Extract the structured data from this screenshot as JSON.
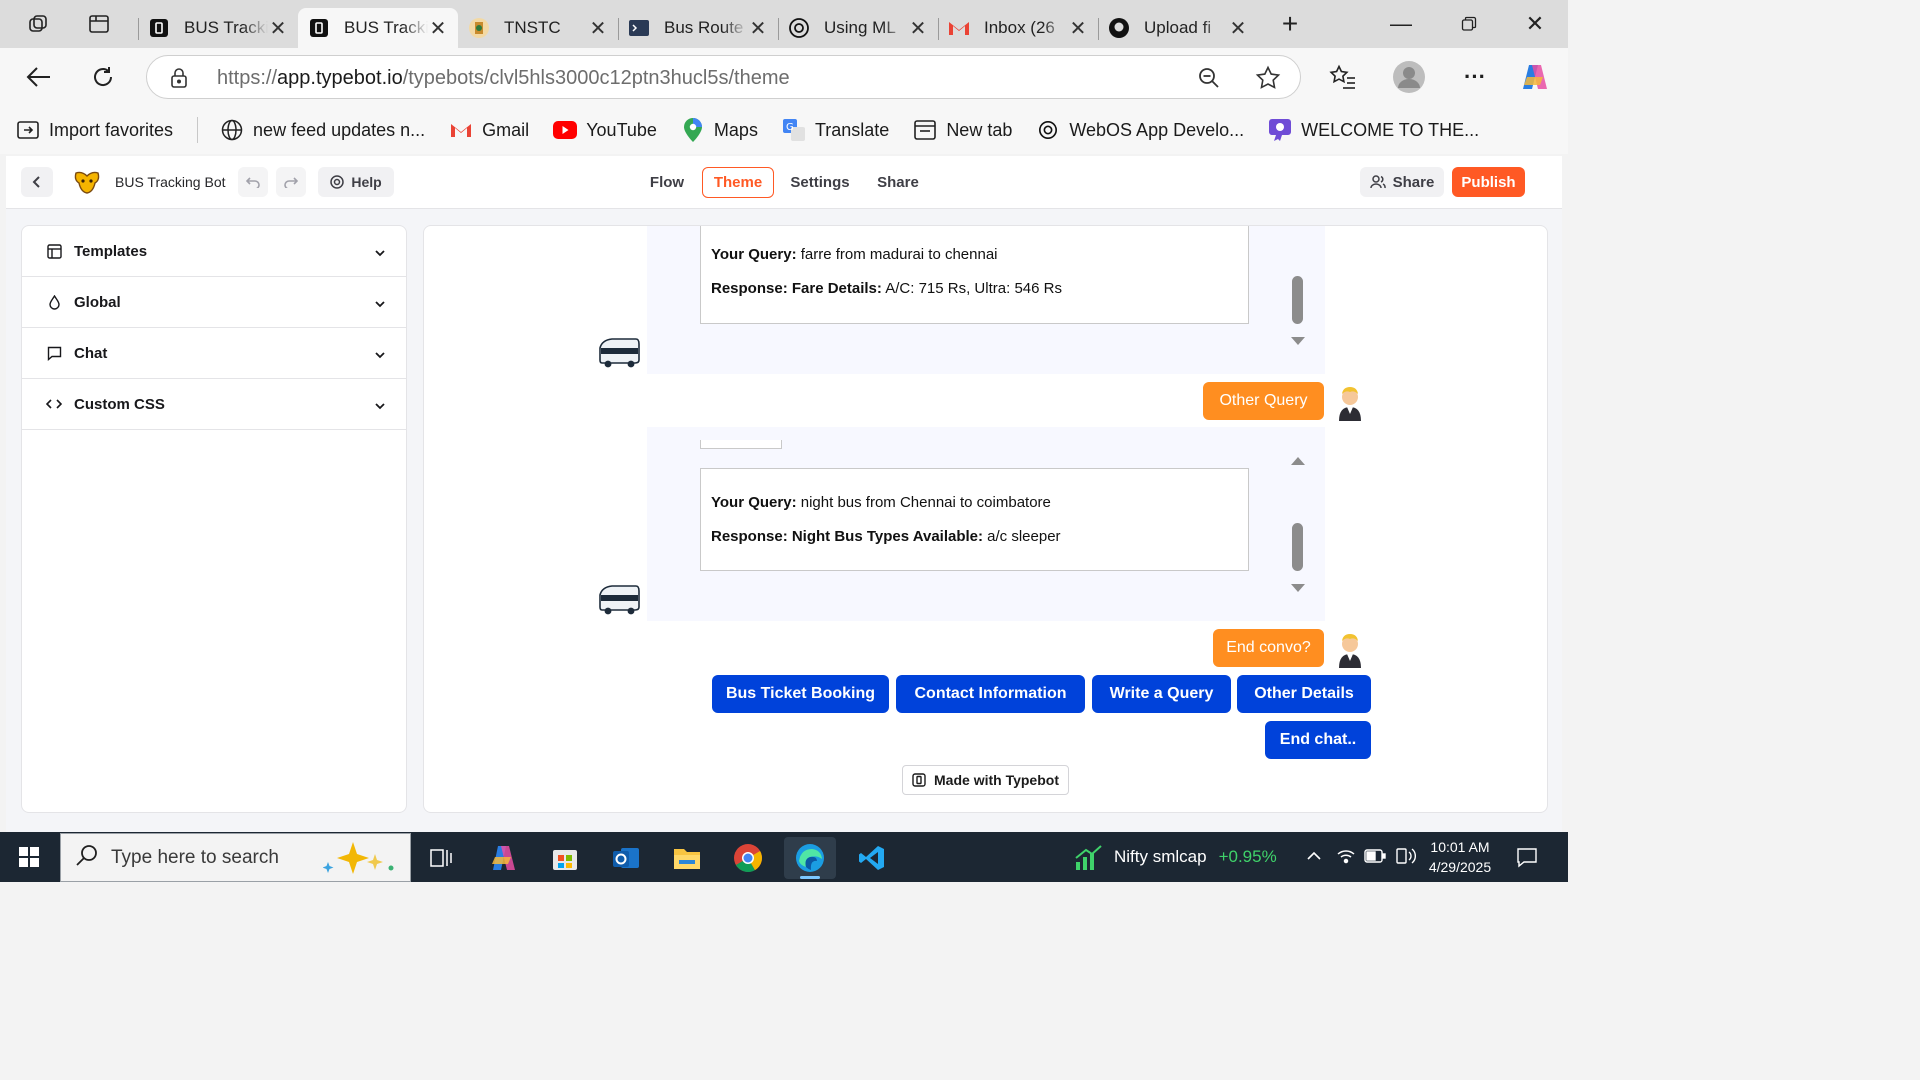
{
  "browser": {
    "tabs": [
      {
        "title": "BUS Tracking Bot",
        "icon": "typebot-icon"
      },
      {
        "title": "BUS Tracking Bot",
        "icon": "typebot-icon",
        "active": true
      },
      {
        "title": "TNSTC",
        "icon": "tnstc-emblem-icon"
      },
      {
        "title": "Bus Route",
        "icon": "terminal-icon"
      },
      {
        "title": "Using ML",
        "icon": "openai-icon"
      },
      {
        "title": "Inbox (26",
        "icon": "gmail-icon"
      },
      {
        "title": "Upload fi",
        "icon": "github-icon"
      }
    ],
    "url_prefix": "https://",
    "url_host": "app.typebot.io",
    "url_path": "/typebots/clvl5hls3000c12ptn3hucl5s/theme",
    "bookmarks": [
      {
        "label": "Import favorites",
        "icon": "import-icon"
      },
      {
        "label": "new feed updates n...",
        "icon": "globe-icon"
      },
      {
        "label": "Gmail",
        "icon": "gmail-icon"
      },
      {
        "label": "YouTube",
        "icon": "youtube-icon"
      },
      {
        "label": "Maps",
        "icon": "maps-pin-icon"
      },
      {
        "label": "Translate",
        "icon": "translate-icon"
      },
      {
        "label": "New tab",
        "icon": "newtab-icon"
      },
      {
        "label": "WebOS App Develo...",
        "icon": "openai-icon"
      },
      {
        "label": "WELCOME TO THE...",
        "icon": "badge-icon"
      }
    ]
  },
  "app": {
    "bot_name": "BUS Tracking Bot",
    "help_label": "Help",
    "nav": [
      {
        "label": "Flow"
      },
      {
        "label": "Theme",
        "active": true
      },
      {
        "label": "Settings"
      },
      {
        "label": "Share"
      }
    ],
    "share_label": "Share",
    "publish_label": "Publish",
    "accent_color": "#ff5924",
    "sidebar": [
      {
        "label": "Templates",
        "icon": "template-icon"
      },
      {
        "label": "Global",
        "icon": "droplet-icon"
      },
      {
        "label": "Chat",
        "icon": "chat-bubble-icon"
      },
      {
        "label": "Custom CSS",
        "icon": "code-icon"
      }
    ]
  },
  "chat": {
    "messages": [
      {
        "query_label": "Your Query:",
        "query": "farre from madurai to chennai",
        "response_label": "Response: Fare Details:",
        "response": "A/C: 715 Rs, Ultra: 546 Rs"
      },
      {
        "query_label": "Your Query:",
        "query": "night bus from Chennai to coimbatore",
        "response_label": "Response: Night Bus Types Available:",
        "response": "a/c sleeper"
      }
    ],
    "user_replies": [
      "Other Query",
      "End convo?"
    ],
    "choices": [
      "Bus Ticket Booking",
      "Contact Information",
      "Write a Query",
      "Other Details",
      "End chat.."
    ],
    "branding": "Made with Typebot",
    "user_bubble_color": "#ff8e20",
    "choice_color": "#0042da"
  },
  "taskbar": {
    "search_placeholder": "Type here to search",
    "ticker_name": "Nifty smlcap",
    "ticker_change": "+0.95%",
    "time": "10:01 AM",
    "date": "4/29/2025"
  }
}
